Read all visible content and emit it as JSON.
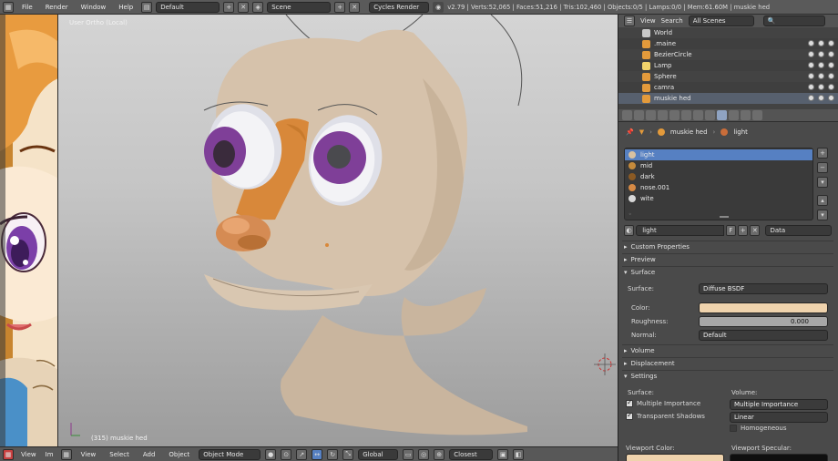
{
  "topbar": {
    "menus": [
      "File",
      "Render",
      "Window",
      "Help"
    ],
    "layout": "Default",
    "scene": "Scene",
    "engine": "Cycles Render",
    "stats": "v2.79 | Verts:52,065 | Faces:51,216 | Tris:102,460 | Objects:0/5 | Lamps:0/0 | Mem:61.60M | muskie hed"
  },
  "viewport": {
    "label": "User Ortho (Local)",
    "object_label": "(315) muskie hed"
  },
  "bottombar": {
    "items": [
      "View",
      "Select",
      "Add",
      "Object"
    ],
    "left_cut": [
      "View",
      "Im"
    ],
    "mode": "Object Mode",
    "pivot": "Global",
    "snap": "Closest"
  },
  "outliner": {
    "view": "View",
    "search": "Search",
    "scenes": "All Scenes",
    "rows": [
      {
        "name": "World",
        "icon_color": "#c9c9c9"
      },
      {
        "name": ".maine",
        "icon_color": "#e39a3b"
      },
      {
        "name": "BezierCircle",
        "icon_color": "#e39a3b"
      },
      {
        "name": "Lamp",
        "icon_color": "#f2d36b"
      },
      {
        "name": "Sphere",
        "icon_color": "#e39a3b"
      },
      {
        "name": "camra",
        "icon_color": "#e39a3b"
      },
      {
        "name": "muskie hed",
        "icon_color": "#e39a3b"
      }
    ]
  },
  "properties": {
    "crumb_object": "muskie hed",
    "crumb_material": "light",
    "slots": [
      {
        "name": "light",
        "color": "#d8c1a1"
      },
      {
        "name": "mid",
        "color": "#c58a3b"
      },
      {
        "name": "dark",
        "color": "#8b5a24"
      },
      {
        "name": "nose.001",
        "color": "#d68a45"
      },
      {
        "name": "wite",
        "color": "#d8d8d8"
      }
    ],
    "material_name": "light",
    "material_f": "F",
    "link": "Data",
    "sections": {
      "custom_properties": "Custom Properties",
      "preview": "Preview",
      "surface": "Surface",
      "volume": "Volume",
      "displacement": "Displacement",
      "settings": "Settings"
    },
    "surface_label": "Surface:",
    "shader": "Diffuse BSDF",
    "color_label": "Color:",
    "color_value": "#efd3ad",
    "roughness_label": "Roughness:",
    "roughness_value": "0.000",
    "normal_label": "Normal:",
    "normal_value": "Default",
    "settings_surface": "Surface:",
    "settings_volume": "Volume:",
    "multiple_importance": "Multiple Importance",
    "transparent_shadows": "Transparent Shadows",
    "volume_sampling": "Multiple Importance",
    "interpolation": "Linear",
    "homogeneous": "Homogeneous",
    "viewport_color": "Viewport Color:",
    "viewport_specular": "Viewport Specular:"
  }
}
